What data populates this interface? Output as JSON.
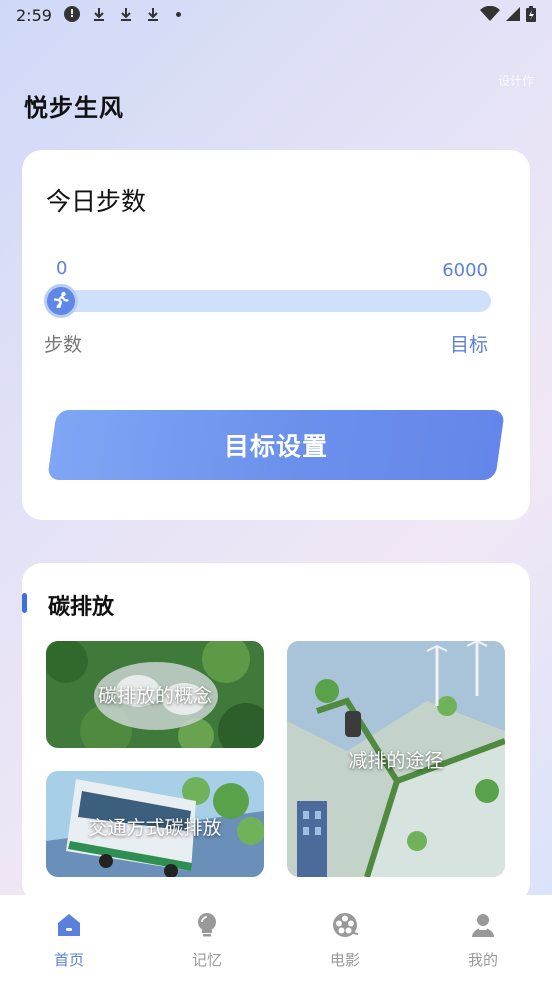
{
  "status_bar": {
    "time": "2:59"
  },
  "header": {
    "title": "悦步生风",
    "corner_mark": "设计作"
  },
  "steps_card": {
    "title": "今日步数",
    "current_steps": "0",
    "target_steps": "6000",
    "progress": 0,
    "steps_label": "步数",
    "target_label": "目标",
    "goal_button_label": "目标设置"
  },
  "carbon_section": {
    "title": "碳排放",
    "tiles": [
      {
        "label": "碳排放的概念"
      },
      {
        "label": "减排的途径"
      },
      {
        "label": "交通方式碳排放"
      }
    ]
  },
  "bottom_nav": {
    "items": [
      {
        "label": "首页",
        "icon": "home-icon",
        "active": true
      },
      {
        "label": "记忆",
        "icon": "bulb-icon",
        "active": false
      },
      {
        "label": "电影",
        "icon": "film-reel-icon",
        "active": false
      },
      {
        "label": "我的",
        "icon": "user-icon",
        "active": false
      }
    ]
  },
  "colors": {
    "accent": "#5b80dc",
    "progress_track": "#cfe0fb",
    "inactive_nav": "#999999"
  }
}
